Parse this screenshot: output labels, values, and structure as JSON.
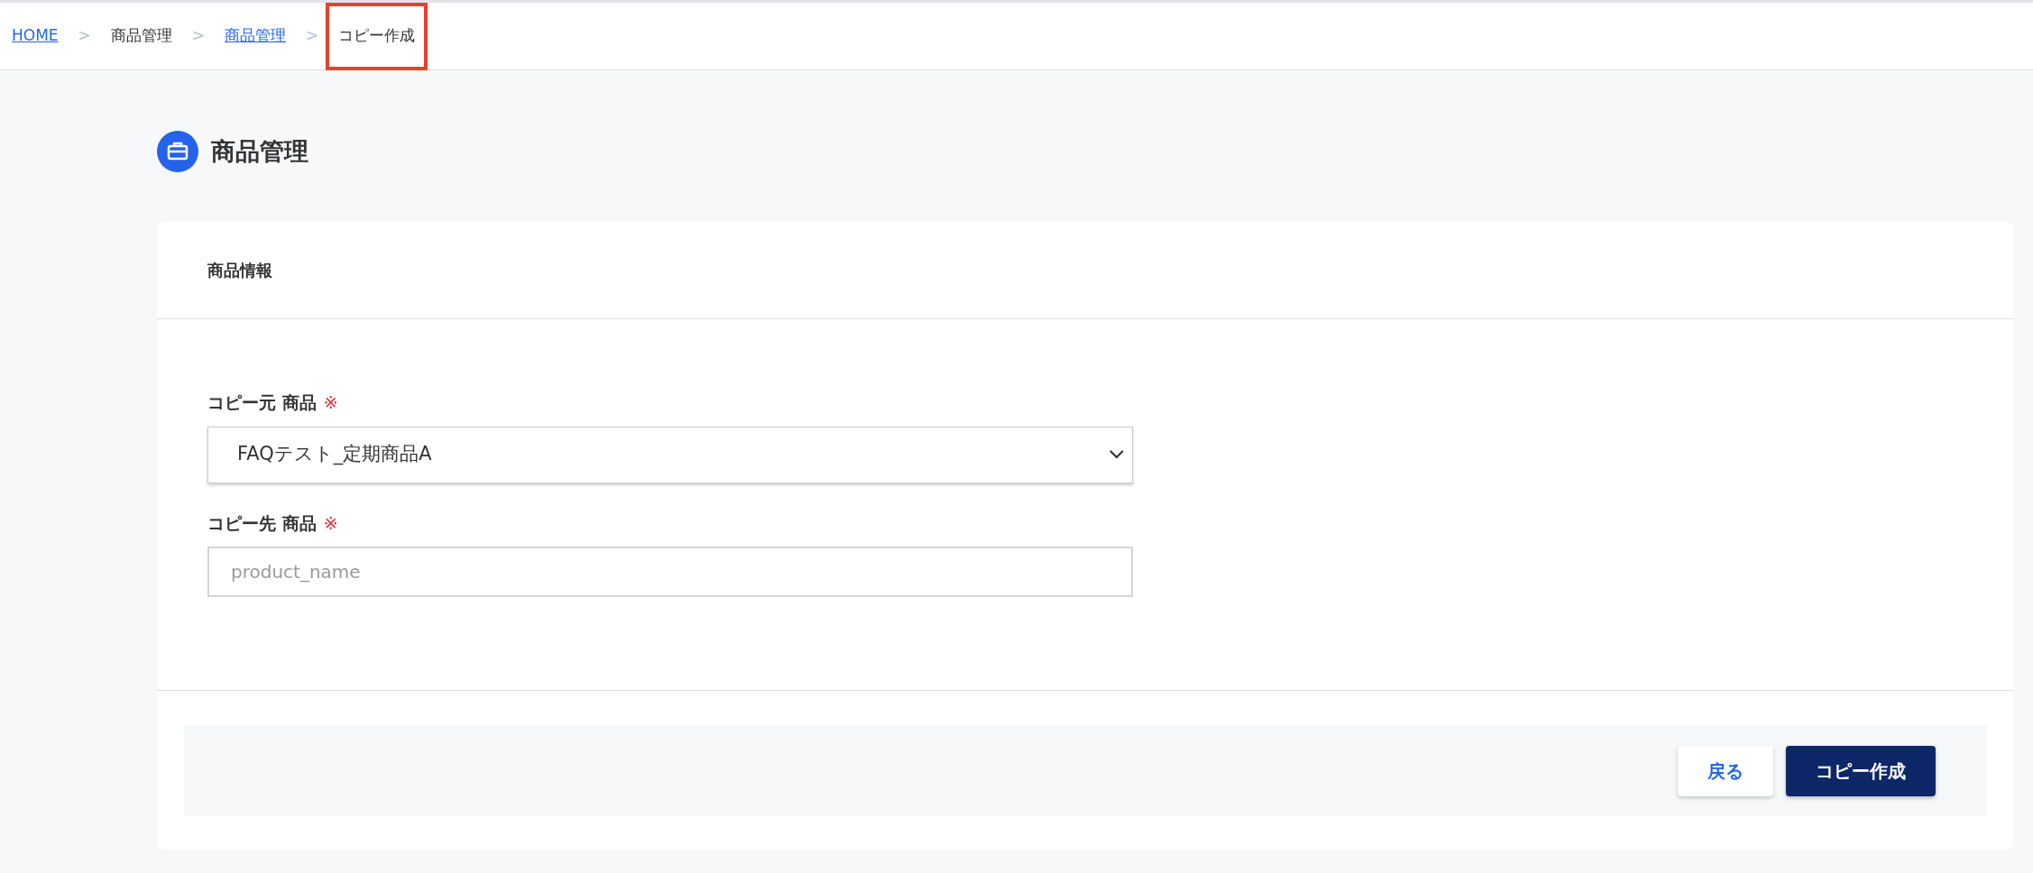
{
  "breadcrumb": [
    {
      "label": "HOME",
      "kind": "link",
      "highlighted": false
    },
    {
      "separator": ">",
      "label": "商品管理",
      "kind": "text",
      "highlighted": false
    },
    {
      "separator": ">",
      "label": "商品管理",
      "kind": "link",
      "highlighted": false
    },
    {
      "separator": ">",
      "label": "コピー作成",
      "kind": "text",
      "highlighted": true
    }
  ],
  "page_title": "商品管理",
  "card": {
    "title": "商品情報",
    "fields": [
      {
        "kind": "select",
        "label": "コピー元 商品",
        "required_mark": "※",
        "value": "FAQテスト_定期商品A"
      },
      {
        "kind": "input",
        "label": "コピー先 商品",
        "required_mark": "※",
        "placeholder": "product_name"
      }
    ],
    "buttons": [
      {
        "kind": "secondary",
        "label": "戻る"
      },
      {
        "kind": "primary",
        "label": "コピー作成"
      }
    ]
  }
}
